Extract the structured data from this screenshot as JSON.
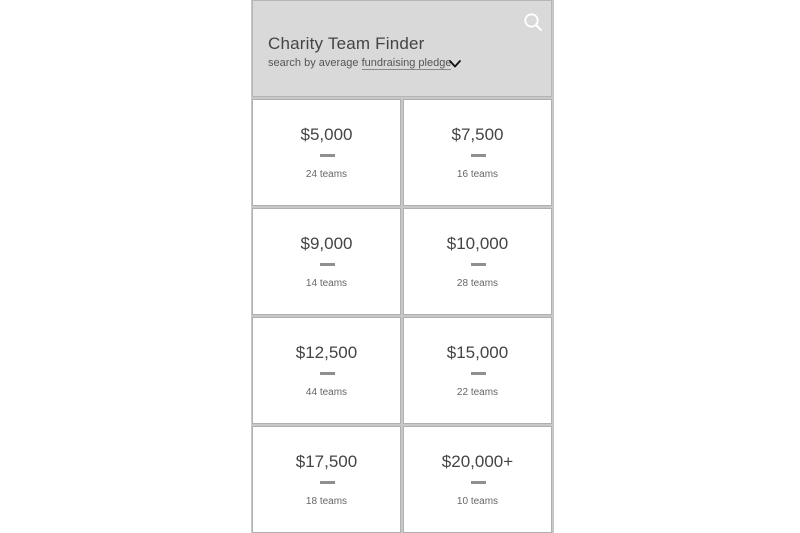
{
  "header": {
    "title": "Charity Team Finder",
    "subtitle_prefix": "search by average",
    "criterion": "fundraising pledge",
    "search_icon": "search-icon",
    "dropdown_icon": "chevron-down-icon"
  },
  "tiles": [
    {
      "amount": "$5,000",
      "count": "24 teams"
    },
    {
      "amount": "$7,500",
      "count": "16 teams"
    },
    {
      "amount": "$9,000",
      "count": "14 teams"
    },
    {
      "amount": "$10,000",
      "count": "28 teams"
    },
    {
      "amount": "$12,500",
      "count": "44 teams"
    },
    {
      "amount": "$15,000",
      "count": "22 teams"
    },
    {
      "amount": "$17,500",
      "count": "18 teams"
    },
    {
      "amount": "$20,000+",
      "count": "10 teams"
    }
  ],
  "colors": {
    "header_bg": "#d9d9d9",
    "frame": "#c8c8c8",
    "tile_bg": "#ffffff",
    "text": "#444444",
    "bar": "#8f8f8f"
  }
}
